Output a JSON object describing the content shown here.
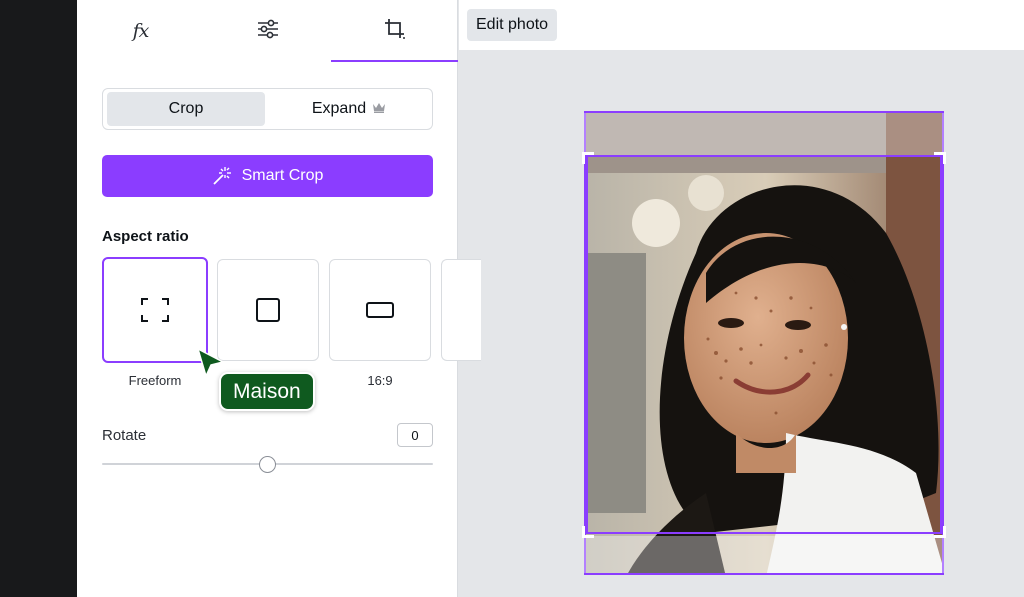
{
  "editor": {
    "header_button": "Edit photo"
  },
  "tabs": [
    {
      "icon": "fx-effects-icon",
      "label": "fx"
    },
    {
      "icon": "adjust-sliders-icon"
    },
    {
      "icon": "crop-icon",
      "active": true
    }
  ],
  "segment": {
    "crop_label": "Crop",
    "expand_label": "Expand",
    "expand_icon": "crown-icon"
  },
  "smart_crop": {
    "label": "Smart Crop",
    "icon": "magic-wand-icon"
  },
  "aspect": {
    "title": "Aspect ratio",
    "options": [
      {
        "label": "Freeform",
        "icon": "freeform-icon",
        "selected": true
      },
      {
        "label": "",
        "icon": "square-icon"
      },
      {
        "label": "16:9",
        "icon": "wide-rectangle-icon"
      },
      {
        "label": "",
        "icon": "more-ratio-icon"
      }
    ]
  },
  "rotate": {
    "label": "Rotate",
    "value": "0"
  },
  "collaborator": {
    "name": "Maison",
    "color": "#0f5a1f"
  },
  "colors": {
    "accent": "#8b3dff",
    "rail": "#18191b",
    "canvas": "#e4e6e9"
  }
}
